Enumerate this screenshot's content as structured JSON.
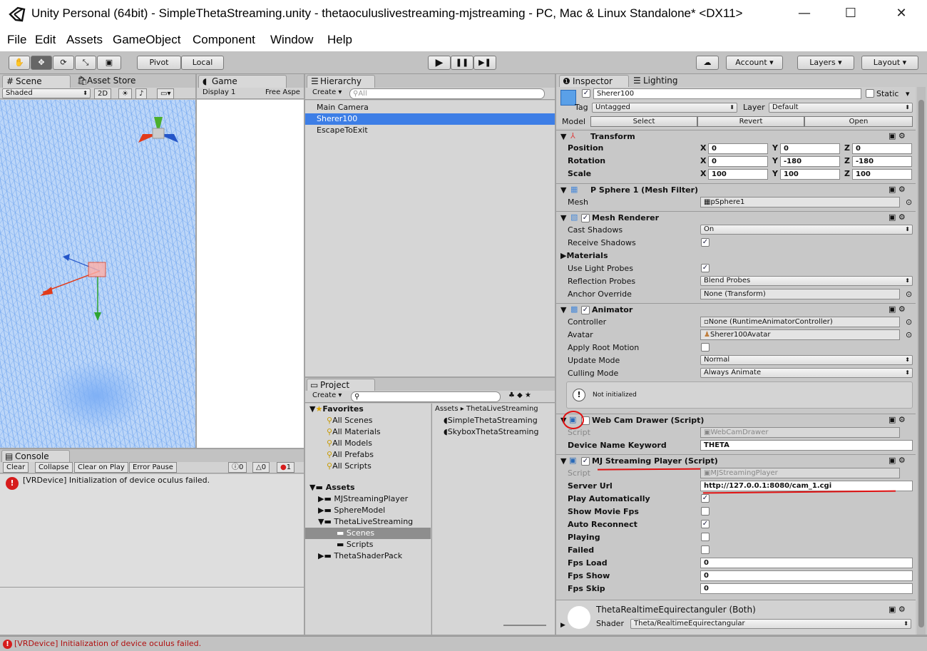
{
  "window": {
    "title": "Unity Personal (64bit) - SimpleThetaStreaming.unity - thetaoculuslivestreaming-mjstreaming - PC, Mac & Linux Standalone* <DX11>",
    "minimize": "—",
    "maximize": "☐",
    "close": "✕"
  },
  "menu": [
    "File",
    "Edit",
    "Assets",
    "GameObject",
    "Component",
    "Window",
    "Help"
  ],
  "toolbar": {
    "tools": [
      "✋",
      "✥",
      "⟳",
      "⤡",
      "▣"
    ],
    "pivot": "Pivot",
    "local": "Local",
    "play": "▶",
    "pause": "❚❚",
    "step": "▶❚",
    "account": "Account",
    "layers": "Layers",
    "layout": "Layout"
  },
  "scene": {
    "tab": "Scene",
    "tab2": "Asset Store",
    "shading": "Shaded",
    "mode2d": "2D"
  },
  "game": {
    "tab": "Game",
    "display": "Display 1",
    "aspect": "Free Aspe"
  },
  "hierarchy": {
    "tab": "Hierarchy",
    "create": "Create",
    "search_placeholder": "All",
    "items": [
      "Main Camera",
      "Sherer100",
      "EscapeToExit"
    ]
  },
  "project": {
    "tab": "Project",
    "create": "Create",
    "favorites_label": "Favorites",
    "favorites": [
      "All Scenes",
      "All Materials",
      "All Models",
      "All Prefabs",
      "All Scripts"
    ],
    "assets_label": "Assets",
    "assets": [
      "MJStreamingPlayer",
      "SphereModel",
      "ThetaLiveStreaming",
      "Scenes",
      "Scripts",
      "ThetaShaderPack"
    ],
    "breadcrumb": "Assets ▸ ThetaLiveStreaming",
    "files": [
      "SimpleThetaStreaming",
      "SkyboxThetaStreaming"
    ]
  },
  "console": {
    "tab": "Console",
    "buttons": [
      "Clear",
      "Collapse",
      "Clear on Play",
      "Error Pause"
    ],
    "info_count": "0",
    "warn_count": "0",
    "error_count": "1",
    "message": "[VRDevice] Initialization of device oculus failed."
  },
  "statusbar": {
    "message": "[VRDevice] Initialization of device oculus failed."
  },
  "inspector": {
    "tab": "Inspector",
    "tab2": "Lighting",
    "object_name": "Sherer100",
    "static_label": "Static",
    "tag_label": "Tag",
    "tag_value": "Untagged",
    "layer_label": "Layer",
    "layer_value": "Default",
    "model_label": "Model",
    "select": "Select",
    "revert": "Revert",
    "open": "Open",
    "transform": {
      "title": "Transform",
      "rows": [
        {
          "label": "Position",
          "x": "0",
          "y": "0",
          "z": "0"
        },
        {
          "label": "Rotation",
          "x": "0",
          "y": "-180",
          "z": "-180"
        },
        {
          "label": "Scale",
          "x": "100",
          "y": "100",
          "z": "100"
        }
      ]
    },
    "meshfilter": {
      "title": "P Sphere 1 (Mesh Filter)",
      "mesh_label": "Mesh",
      "mesh_value": "pSphere1"
    },
    "meshrenderer": {
      "title": "Mesh Renderer",
      "cast_shadows": "Cast Shadows",
      "cast_shadows_value": "On",
      "receive_shadows": "Receive Shadows",
      "materials": "Materials",
      "use_light_probes": "Use Light Probes",
      "reflection_probes": "Reflection Probes",
      "reflection_probes_value": "Blend Probes",
      "anchor_override": "Anchor Override",
      "anchor_override_value": "None (Transform)"
    },
    "animator": {
      "title": "Animator",
      "controller": "Controller",
      "controller_value": "None (RuntimeAnimatorController)",
      "avatar": "Avatar",
      "avatar_value": "Sherer100Avatar",
      "apply_root_motion": "Apply Root Motion",
      "update_mode": "Update Mode",
      "update_mode_value": "Normal",
      "culling_mode": "Culling Mode",
      "culling_mode_value": "Always Animate",
      "notice": "Not initialized"
    },
    "webcam": {
      "title": "Web Cam Drawer (Script)",
      "script_label": "Script",
      "script_value": "WebCamDrawer",
      "device_label": "Device Name Keyword",
      "device_value": "THETA"
    },
    "mjstream": {
      "title": "MJ Streaming Player (Script)",
      "script_label": "Script",
      "script_value": "MJStreamingPlayer",
      "server_url_label": "Server Url",
      "server_url_value": "http://127.0.0.1:8080/cam_1.cgi",
      "play_auto": "Play Automatically",
      "show_fps": "Show Movie Fps",
      "auto_reconnect": "Auto Reconnect",
      "playing": "Playing",
      "failed": "Failed",
      "fps_load": "Fps Load",
      "fps_load_value": "0",
      "fps_show": "Fps Show",
      "fps_show_value": "0",
      "fps_skip": "Fps Skip",
      "fps_skip_value": "0"
    },
    "material": {
      "name": "ThetaRealtimeEquirectanguler (Both)",
      "shader_label": "Shader",
      "shader_value": "Theta/RealtimeEquirectangular"
    }
  },
  "colors": {
    "selection": "#3d7ee6",
    "annotation": "#e01010",
    "error": "#d61c1c"
  }
}
